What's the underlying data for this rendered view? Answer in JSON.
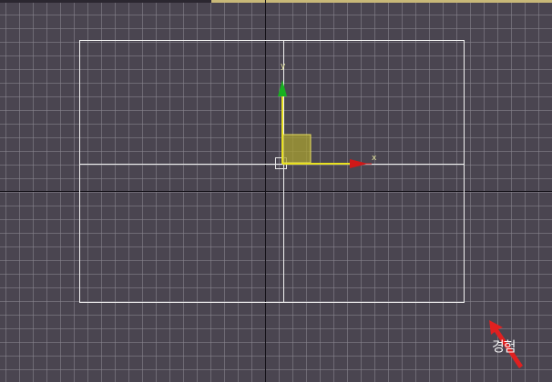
{
  "viewport": {
    "background": "#4a4550",
    "grid_color": "#8c8892",
    "home_grid_color": "#121016",
    "object_color": "#f2f2f2"
  },
  "gizmo": {
    "x_label": "x",
    "y_label": "y",
    "x_color": "#d01818",
    "y_color": "#18b020",
    "plane_color": "#c8c040"
  },
  "overlay": {
    "arrow_icon": "red-arrow-icon",
    "watermark_text": "경험"
  }
}
